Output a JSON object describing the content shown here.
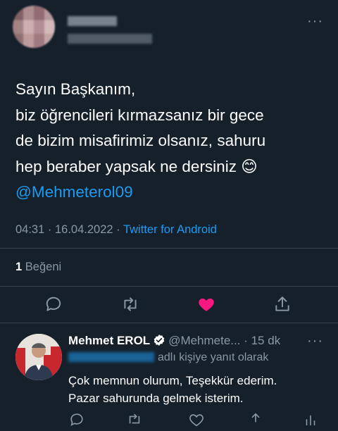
{
  "tweet": {
    "lines": [
      "Sayın Başkanım,",
      "biz öğrencileri kırmazsanız bir gece",
      "de bizim misafirimiz olsanız, sahuru",
      "hep beraber yapsak ne dersiniz 😊"
    ],
    "mention": "@Mehmeterol09",
    "time": "04:31",
    "separator": "·",
    "date": "16.04.2022",
    "source": "Twitter for Android",
    "like_count": "1",
    "like_label": "Beğeni",
    "more_label": "···"
  },
  "reply": {
    "name": "Mehmet EROL",
    "handle": "@Mehmete...",
    "time_ago": "· 15 dk",
    "more_label": "···",
    "replying_to": "adlı kişiye yanıt olarak",
    "lines": [
      "Çok memnun olurum, Teşekkür ederim.",
      "Pazar sahurunda gelmek isterim."
    ]
  },
  "colors": {
    "background": "#15202b",
    "accent": "#1d9bf0",
    "muted": "#8b98a5",
    "like": "#f91880"
  },
  "icons": [
    "reply-icon",
    "retweet-icon",
    "heart-icon",
    "share-icon",
    "verified-icon",
    "more-icon"
  ]
}
